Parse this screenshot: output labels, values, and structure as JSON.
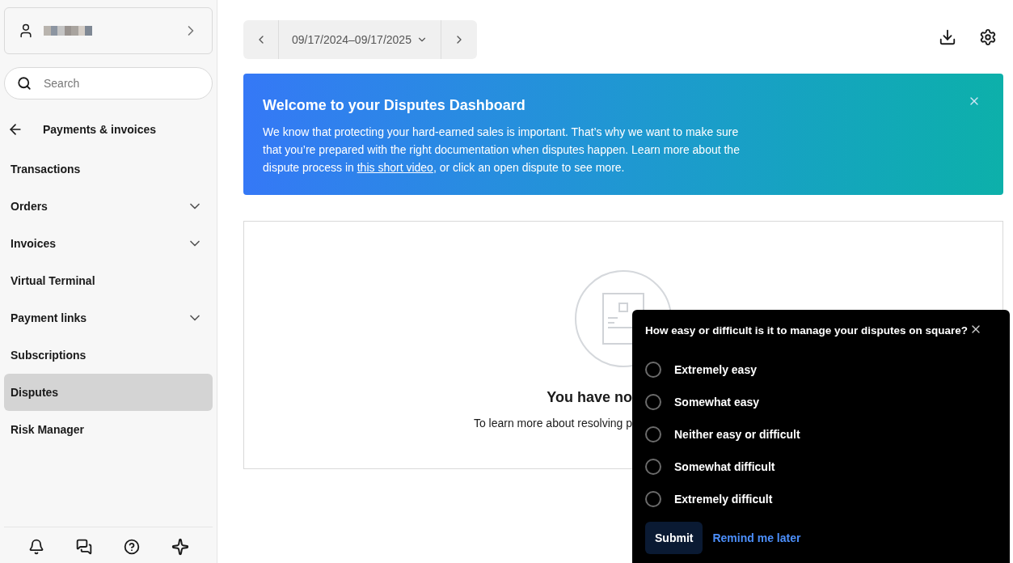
{
  "sidebar": {
    "search": {
      "placeholder": "Search"
    },
    "section_title": "Payments & invoices",
    "items": [
      {
        "label": "Transactions",
        "expandable": false,
        "selected": false
      },
      {
        "label": "Orders",
        "expandable": true,
        "selected": false
      },
      {
        "label": "Invoices",
        "expandable": true,
        "selected": false
      },
      {
        "label": "Virtual Terminal",
        "expandable": false,
        "selected": false
      },
      {
        "label": "Payment links",
        "expandable": true,
        "selected": false
      },
      {
        "label": "Subscriptions",
        "expandable": false,
        "selected": false
      },
      {
        "label": "Disputes",
        "expandable": false,
        "selected": true
      },
      {
        "label": "Risk Manager",
        "expandable": false,
        "selected": false
      }
    ]
  },
  "date_range": "09/17/2024–09/17/2025",
  "banner": {
    "title": "Welcome to your Disputes Dashboard",
    "text_before": "We know that protecting your hard-earned sales is important. That’s why we want to make sure that you’re prepared with the right documentation when disputes happen. Learn more about the dispute process in",
    "link": "this short video",
    "text_after": ", or click an open dispute to see more."
  },
  "empty_state": {
    "title": "You have no",
    "text": "To learn more about resolving p"
  },
  "survey": {
    "question": "How easy or difficult is it to manage your disputes on square?",
    "options": [
      {
        "label": "Extremely easy",
        "selected": false
      },
      {
        "label": "Somewhat easy",
        "selected": false
      },
      {
        "label": "Neither easy or difficult",
        "selected": false
      },
      {
        "label": "Somewhat difficult",
        "selected": false
      },
      {
        "label": "Extremely difficult",
        "selected": false
      }
    ],
    "submit": "Submit",
    "remind": "Remind me later"
  }
}
